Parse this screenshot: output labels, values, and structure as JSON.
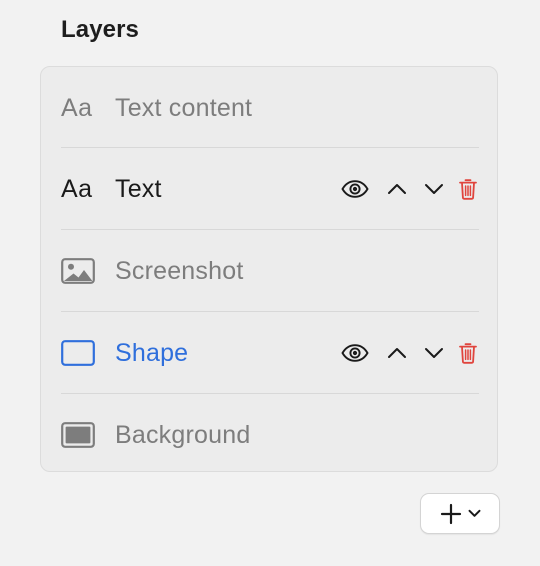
{
  "panel": {
    "title": "Layers"
  },
  "layers": [
    {
      "label": "Text content",
      "icon": "text-aa-icon",
      "icon_text": "Aa",
      "state": "disabled"
    },
    {
      "label": "Text",
      "icon": "text-aa-icon",
      "icon_text": "Aa",
      "state": "normal",
      "actions": [
        "eye-icon",
        "chevron-up-icon",
        "chevron-down-icon",
        "trash-icon"
      ]
    },
    {
      "label": "Screenshot",
      "icon": "image-icon",
      "state": "disabled"
    },
    {
      "label": "Shape",
      "icon": "rectangle-shape-icon",
      "state": "selected",
      "actions": [
        "eye-icon",
        "chevron-up-icon",
        "chevron-down-icon",
        "trash-icon"
      ]
    },
    {
      "label": "Background",
      "icon": "filled-rectangle-icon",
      "state": "disabled"
    }
  ],
  "add_button": {
    "icons": [
      "plus-icon",
      "chevron-down-icon"
    ]
  },
  "colors": {
    "background": "#f2f2f2",
    "box": "#ececec",
    "dim_text": "#7d7d7d",
    "selected_blue": "#2f6fdc",
    "delete_red": "#e0443d"
  }
}
